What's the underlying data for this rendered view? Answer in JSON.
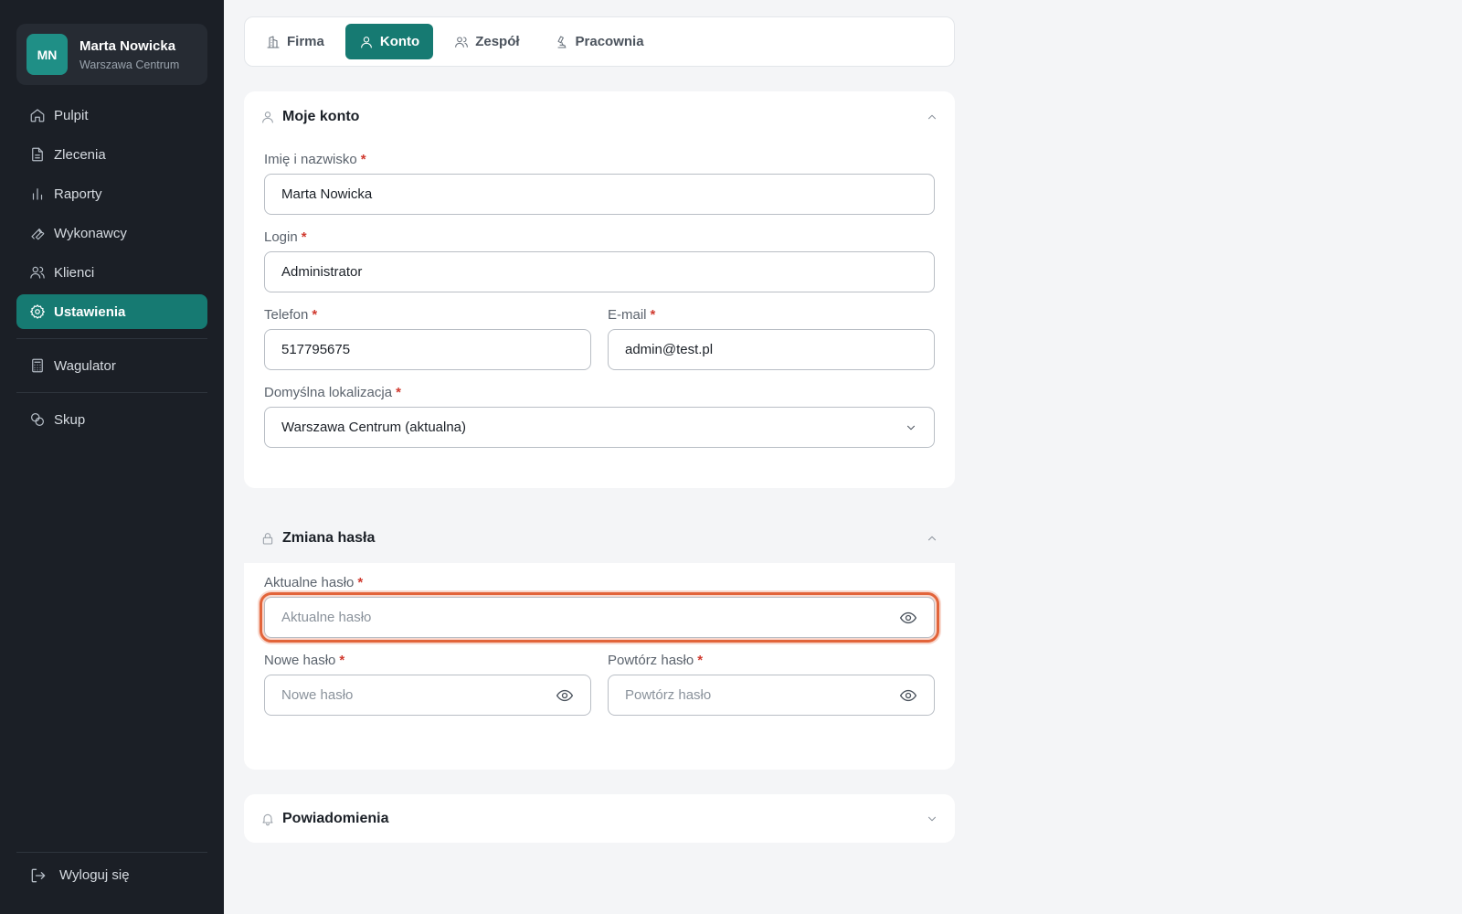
{
  "user": {
    "initials": "MN",
    "name": "Marta Nowicka",
    "location": "Warszawa Centrum"
  },
  "nav": {
    "items": [
      {
        "label": "Pulpit",
        "icon": "home-icon"
      },
      {
        "label": "Zlecenia",
        "icon": "document-icon"
      },
      {
        "label": "Raporty",
        "icon": "bar-chart-icon"
      },
      {
        "label": "Wykonawcy",
        "icon": "wrench-icon"
      },
      {
        "label": "Klienci",
        "icon": "users-icon"
      },
      {
        "label": "Ustawienia",
        "icon": "gear-icon",
        "active": true
      }
    ],
    "extra1": {
      "label": "Wagulator",
      "icon": "calculator-icon"
    },
    "extra2": {
      "label": "Skup",
      "icon": "coins-icon"
    },
    "logout": "Wyloguj się"
  },
  "tabs": [
    {
      "label": "Firma",
      "icon": "building-icon"
    },
    {
      "label": "Konto",
      "icon": "user-icon",
      "active": true
    },
    {
      "label": "Zespół",
      "icon": "team-icon"
    },
    {
      "label": "Pracownia",
      "icon": "microscope-icon"
    }
  ],
  "account": {
    "title": "Moje konto",
    "full_name_label": "Imię i nazwisko",
    "full_name_value": "Marta Nowicka",
    "login_label": "Login",
    "login_value": "Administrator",
    "phone_label": "Telefon",
    "phone_value": "517795675",
    "email_label": "E-mail",
    "email_value": "admin@test.pl",
    "location_label": "Domyślna lokalizacja",
    "location_value": "Warszawa Centrum (aktualna)"
  },
  "password": {
    "title": "Zmiana hasła",
    "current_label": "Aktualne hasło",
    "current_placeholder": "Aktualne hasło",
    "new_label": "Nowe hasło",
    "new_placeholder": "Nowe hasło",
    "repeat_label": "Powtórz hasło",
    "repeat_placeholder": "Powtórz hasło"
  },
  "notifications": {
    "title": "Powiadomienia"
  },
  "required_mark": "*",
  "colors": {
    "accent": "#167a72",
    "sidebar_bg": "#1b1f26",
    "focus_ring": "#e2643a",
    "required": "#d03a2f"
  }
}
